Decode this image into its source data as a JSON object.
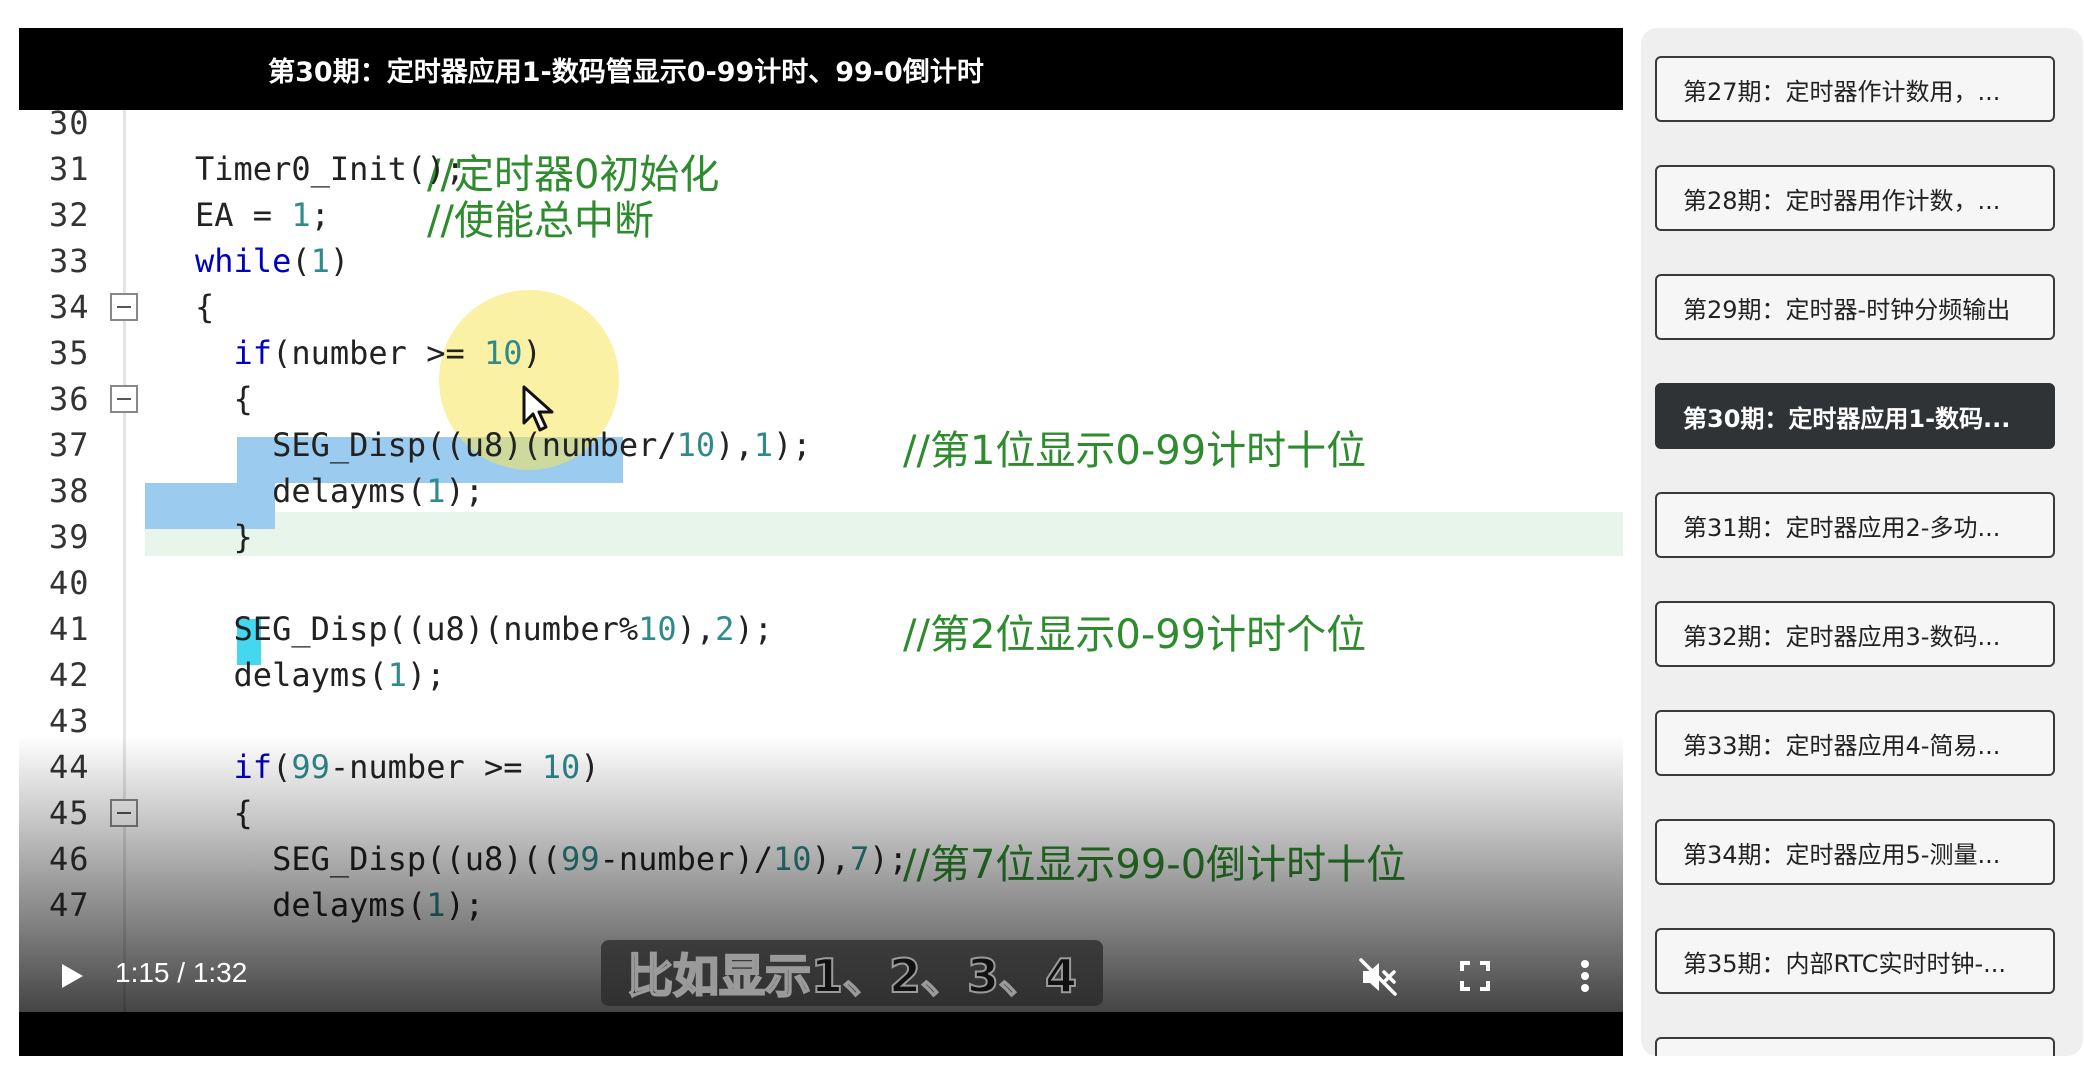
{
  "video": {
    "title": "第30期：定时器应用1-数码管显示0-99计时、99-0倒计时",
    "subtitle": "比如显示1、2、3、4",
    "time_current": "1:15",
    "time_total": "1:32",
    "time_display": "1:15 / 1:32",
    "progress": 0.815
  },
  "code_lines": [
    {
      "ln": "30",
      "parts": []
    },
    {
      "ln": "31",
      "parts": [
        {
          "t": "Timer0_Init();",
          "c": ""
        },
        {
          "t": "//定时器0初始化",
          "c": "cm",
          "col": 1
        }
      ]
    },
    {
      "ln": "32",
      "parts": [
        {
          "t": "EA = ",
          "c": ""
        },
        {
          "t": "1",
          "c": "num"
        },
        {
          "t": ";",
          "c": ""
        },
        {
          "t": "//使能总中断",
          "c": "cm",
          "col": 1
        }
      ]
    },
    {
      "ln": "33",
      "parts": [
        {
          "t": "while",
          "c": "kw"
        },
        {
          "t": "(",
          "c": ""
        },
        {
          "t": "1",
          "c": "num"
        },
        {
          "t": ")",
          "c": ""
        }
      ]
    },
    {
      "ln": "34",
      "parts": [
        {
          "t": "{",
          "c": ""
        }
      ]
    },
    {
      "ln": "35",
      "parts": [
        {
          "t": "  if",
          "c": "kw"
        },
        {
          "t": "(number >= ",
          "c": ""
        },
        {
          "t": "10",
          "c": "num"
        },
        {
          "t": ")",
          "c": ""
        }
      ]
    },
    {
      "ln": "36",
      "parts": [
        {
          "t": "  {",
          "c": ""
        }
      ]
    },
    {
      "ln": "37",
      "parts": [
        {
          "t": "    SEG_Disp((u8)(number/",
          "c": ""
        },
        {
          "t": "10",
          "c": "num"
        },
        {
          "t": "),",
          "c": ""
        },
        {
          "t": "1",
          "c": "num"
        },
        {
          "t": ");",
          "c": ""
        },
        {
          "t": "//第1位显示0-99计时十位",
          "c": "cm",
          "col": 2
        }
      ]
    },
    {
      "ln": "38",
      "parts": [
        {
          "t": "    delayms(",
          "c": ""
        },
        {
          "t": "1",
          "c": "num"
        },
        {
          "t": ");",
          "c": ""
        }
      ]
    },
    {
      "ln": "39",
      "parts": [
        {
          "t": "  }",
          "c": ""
        }
      ]
    },
    {
      "ln": "40",
      "parts": []
    },
    {
      "ln": "41",
      "parts": [
        {
          "t": "  SEG_Disp((u8)(number%",
          "c": ""
        },
        {
          "t": "10",
          "c": "num"
        },
        {
          "t": "),",
          "c": ""
        },
        {
          "t": "2",
          "c": "num"
        },
        {
          "t": ");",
          "c": ""
        },
        {
          "t": "//第2位显示0-99计时个位",
          "c": "cm",
          "col": 2
        }
      ]
    },
    {
      "ln": "42",
      "parts": [
        {
          "t": "  delayms(",
          "c": ""
        },
        {
          "t": "1",
          "c": "num"
        },
        {
          "t": ");",
          "c": ""
        }
      ]
    },
    {
      "ln": "43",
      "parts": []
    },
    {
      "ln": "44",
      "parts": [
        {
          "t": "  if",
          "c": "kw"
        },
        {
          "t": "(",
          "c": ""
        },
        {
          "t": "99",
          "c": "num"
        },
        {
          "t": "-number >= ",
          "c": ""
        },
        {
          "t": "10",
          "c": "num"
        },
        {
          "t": ")",
          "c": ""
        }
      ]
    },
    {
      "ln": "45",
      "parts": [
        {
          "t": "  {",
          "c": ""
        }
      ]
    },
    {
      "ln": "46",
      "parts": [
        {
          "t": "    SEG_Disp((u8)((",
          "c": ""
        },
        {
          "t": "99",
          "c": "num"
        },
        {
          "t": "-number)/",
          "c": ""
        },
        {
          "t": "10",
          "c": "num"
        },
        {
          "t": "),",
          "c": ""
        },
        {
          "t": "7",
          "c": "num"
        },
        {
          "t": ");",
          "c": ""
        },
        {
          "t": "//第7位显示99-0倒计时十位",
          "c": "cm",
          "col": 2
        }
      ]
    },
    {
      "ln": "47",
      "parts": [
        {
          "t": "    delayms(",
          "c": ""
        },
        {
          "t": "1",
          "c": "num"
        },
        {
          "t": ");",
          "c": ""
        }
      ]
    }
  ],
  "playlist": [
    {
      "label": "第27期：定时器作计数用，...",
      "active": false
    },
    {
      "label": "第28期：定时器用作计数，...",
      "active": false
    },
    {
      "label": "第29期：定时器-时钟分频输出",
      "active": false
    },
    {
      "label": "第30期：定时器应用1-数码...",
      "active": true
    },
    {
      "label": "第31期：定时器应用2-多功...",
      "active": false
    },
    {
      "label": "第32期：定时器应用3-数码...",
      "active": false
    },
    {
      "label": "第33期：定时器应用4-简易...",
      "active": false
    },
    {
      "label": "第34期：定时器应用5-测量...",
      "active": false
    },
    {
      "label": "第35期：内部RTC实时时钟-...",
      "active": false
    },
    {
      "label": "",
      "active": false
    }
  ],
  "icons": {
    "play": "play-icon",
    "mute": "volume-muted-icon",
    "fullscreen": "fullscreen-icon",
    "more": "more-vertical-icon",
    "fold": "fold-collapse-icon",
    "cursor": "mouse-cursor-icon"
  },
  "colors": {
    "active_item_bg": "#2f3336",
    "selection": "#9ccbf0",
    "keyword": "#0000c0",
    "comment": "#2e8b2e",
    "number": "#2f8a8a"
  }
}
